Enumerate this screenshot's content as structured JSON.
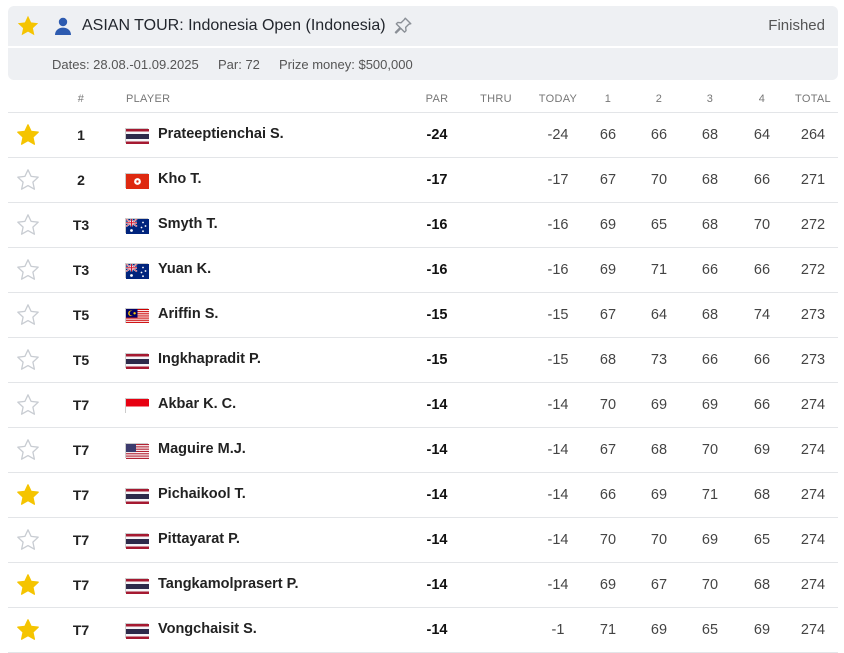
{
  "header": {
    "tour": "ASIAN TOUR: Indonesia Open (Indonesia)",
    "status": "Finished",
    "favorite": true
  },
  "info": {
    "dates": "Dates: 28.08.-01.09.2025",
    "par": "Par: 72",
    "prize": "Prize money: $500,000"
  },
  "columns": {
    "pos": "#",
    "player": "PLAYER",
    "par": "PAR",
    "thru": "THRU",
    "today": "TODAY",
    "r1": "1",
    "r2": "2",
    "r3": "3",
    "r4": "4",
    "total": "TOTAL"
  },
  "colors": {
    "star_active": "#f5c400",
    "star_inactive": "#c8ccd2",
    "accent": "#2d5bb0"
  },
  "rows": [
    {
      "pos": "1",
      "flag": "thailand",
      "name": "Prateeptienchai S.",
      "par": "-24",
      "thru": "",
      "today": "-24",
      "r1": "66",
      "r2": "66",
      "r3": "68",
      "r4": "64",
      "total": "264",
      "fav": true
    },
    {
      "pos": "2",
      "flag": "hong-kong",
      "name": "Kho T.",
      "par": "-17",
      "thru": "",
      "today": "-17",
      "r1": "67",
      "r2": "70",
      "r3": "68",
      "r4": "66",
      "total": "271",
      "fav": false
    },
    {
      "pos": "T3",
      "flag": "australia",
      "name": "Smyth T.",
      "par": "-16",
      "thru": "",
      "today": "-16",
      "r1": "69",
      "r2": "65",
      "r3": "68",
      "r4": "70",
      "total": "272",
      "fav": false
    },
    {
      "pos": "T3",
      "flag": "australia",
      "name": "Yuan K.",
      "par": "-16",
      "thru": "",
      "today": "-16",
      "r1": "69",
      "r2": "71",
      "r3": "66",
      "r4": "66",
      "total": "272",
      "fav": false
    },
    {
      "pos": "T5",
      "flag": "malaysia",
      "name": "Ariffin S.",
      "par": "-15",
      "thru": "",
      "today": "-15",
      "r1": "67",
      "r2": "64",
      "r3": "68",
      "r4": "74",
      "total": "273",
      "fav": false
    },
    {
      "pos": "T5",
      "flag": "thailand",
      "name": "Ingkhapradit P.",
      "par": "-15",
      "thru": "",
      "today": "-15",
      "r1": "68",
      "r2": "73",
      "r3": "66",
      "r4": "66",
      "total": "273",
      "fav": false
    },
    {
      "pos": "T7",
      "flag": "indonesia",
      "name": "Akbar K. C.",
      "par": "-14",
      "thru": "",
      "today": "-14",
      "r1": "70",
      "r2": "69",
      "r3": "69",
      "r4": "66",
      "total": "274",
      "fav": false
    },
    {
      "pos": "T7",
      "flag": "usa",
      "name": "Maguire M.J.",
      "par": "-14",
      "thru": "",
      "today": "-14",
      "r1": "67",
      "r2": "68",
      "r3": "70",
      "r4": "69",
      "total": "274",
      "fav": false
    },
    {
      "pos": "T7",
      "flag": "thailand",
      "name": "Pichaikool T.",
      "par": "-14",
      "thru": "",
      "today": "-14",
      "r1": "66",
      "r2": "69",
      "r3": "71",
      "r4": "68",
      "total": "274",
      "fav": true
    },
    {
      "pos": "T7",
      "flag": "thailand",
      "name": "Pittayarat P.",
      "par": "-14",
      "thru": "",
      "today": "-14",
      "r1": "70",
      "r2": "70",
      "r3": "69",
      "r4": "65",
      "total": "274",
      "fav": false
    },
    {
      "pos": "T7",
      "flag": "thailand",
      "name": "Tangkamolprasert P.",
      "par": "-14",
      "thru": "",
      "today": "-14",
      "r1": "69",
      "r2": "67",
      "r3": "70",
      "r4": "68",
      "total": "274",
      "fav": true
    },
    {
      "pos": "T7",
      "flag": "thailand",
      "name": "Vongchaisit S.",
      "par": "-14",
      "thru": "",
      "today": "-1",
      "r1": "71",
      "r2": "69",
      "r3": "65",
      "r4": "69",
      "total": "274",
      "fav": true
    }
  ]
}
